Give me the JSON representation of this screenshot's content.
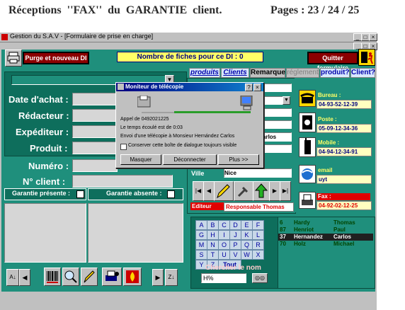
{
  "doc_header": {
    "left": "Réceptions  ''FAX''  du  GARANTIE  client.",
    "right": "Pages : 23 / 24 / 25"
  },
  "window": {
    "title": "Gestion du S.A.V - [Formulaire de prise en charge]",
    "controls": [
      "_",
      "□",
      "×"
    ],
    "sub_controls": [
      "_",
      "□",
      "×"
    ]
  },
  "toolbar": {
    "purge_label": "Purge et nouveau DI",
    "count_label": "Nombre de fiches pour ce  DI : 0",
    "quit_label": "Quitter formulaire"
  },
  "tabs": [
    {
      "label": "produits"
    },
    {
      "label": "Clients"
    },
    {
      "label": "Remarque"
    },
    {
      "label": "réglement"
    },
    {
      "label": "produit?"
    },
    {
      "label": "Client?"
    }
  ],
  "form_labels": {
    "date": "Date d'achat :",
    "redacteur": "Rédacteur :",
    "expediteur": "Expéditeur :",
    "produit": "Produit :",
    "numero": "Numéro :",
    "client": "N° client :",
    "garantie_presente": "Garantie présente :",
    "garantie_absente": "Garantie absente :"
  },
  "client_form": {
    "firstname_value": "arlos",
    "ville_label": "Ville",
    "ville_value": "Nice",
    "editeur_label": "Editeur",
    "editeur_value": "Responsable Thomas"
  },
  "contacts": {
    "bureau_label": "Bureau :",
    "bureau_value": "04-93-52-12-39",
    "poste_label": "Poste :",
    "poste_value": "05-09-12-34-36",
    "mobile_label": "Mobile :",
    "mobile_value": "04-94-12-34-91",
    "email_label": "email",
    "email_value": "uyt",
    "fax_label": "Fax :",
    "fax_value": "04-92-02-12-25"
  },
  "alphabet": [
    "A",
    "B",
    "C",
    "D",
    "E",
    "F",
    "G",
    "H",
    "I",
    "J",
    "K",
    "L",
    "M",
    "N",
    "O",
    "P",
    "Q",
    "R",
    "S",
    "T",
    "U",
    "V",
    "W",
    "X",
    "Y",
    "Z"
  ],
  "alphabet_all": "Tout",
  "search": {
    "label": "Chercher le nom",
    "value": "H%"
  },
  "client_list": [
    {
      "id": "6",
      "last": "Hardy",
      "first": "Thomas"
    },
    {
      "id": "87",
      "last": "Henriot",
      "first": "Paul"
    },
    {
      "id": "37",
      "last": "Hernandez",
      "first": "Carlos"
    },
    {
      "id": "70",
      "last": "Holz",
      "first": "Michael"
    }
  ],
  "dialog": {
    "title": "Moniteur de télécopie",
    "help": "?",
    "close": "×",
    "line1": "Appel de 0492021225",
    "line2": "Le temps écoulé est de 0:03",
    "line3": "Envoi d'une télécopie à Monsieur  Hernández  Carlos",
    "checkbox_label": "Conserver cette boîte de dialogue toujours visible",
    "btn_hide": "Masquer",
    "btn_disconnect": "Déconnecter",
    "btn_more": "Plus >>"
  },
  "colors": {
    "teal": "#1f8f7c",
    "yellow": "#ffff66",
    "fax_red": "#e00000"
  }
}
